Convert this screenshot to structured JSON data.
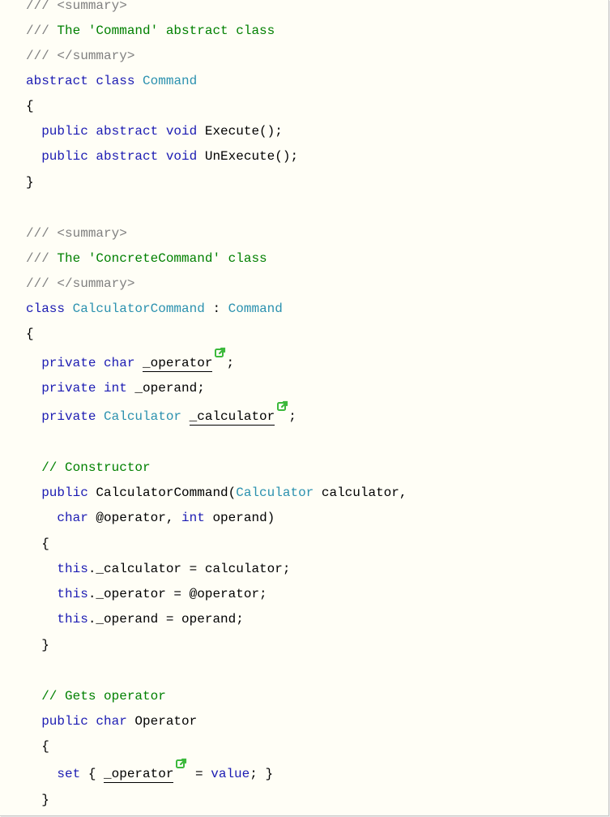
{
  "code_lines": [
    {
      "id": "l0",
      "parts": [
        {
          "t": "/// ",
          "c": "gr"
        },
        {
          "t": "<summary>",
          "c": "gr"
        }
      ]
    },
    {
      "id": "l1",
      "parts": [
        {
          "t": "/// ",
          "c": "gr"
        },
        {
          "t": "The 'Command' abstract class",
          "c": "cm"
        }
      ]
    },
    {
      "id": "l2",
      "parts": [
        {
          "t": "/// ",
          "c": "gr"
        },
        {
          "t": "</summary>",
          "c": "gr"
        }
      ]
    },
    {
      "id": "l3",
      "parts": [
        {
          "t": "abstract class ",
          "c": "kw"
        },
        {
          "t": "Command",
          "c": "ty"
        }
      ]
    },
    {
      "id": "l4",
      "parts": [
        {
          "t": "{",
          "c": ""
        }
      ]
    },
    {
      "id": "l5",
      "parts": [
        {
          "t": "  public abstract void ",
          "c": "kw"
        },
        {
          "t": "Execute();",
          "c": ""
        }
      ]
    },
    {
      "id": "l6",
      "parts": [
        {
          "t": "  public abstract void ",
          "c": "kw"
        },
        {
          "t": "UnExecute();",
          "c": ""
        }
      ]
    },
    {
      "id": "l7",
      "parts": [
        {
          "t": "}",
          "c": ""
        }
      ]
    },
    {
      "id": "l8",
      "parts": [
        {
          "t": "/// ",
          "c": "gr"
        },
        {
          "t": "<summary>",
          "c": "gr"
        }
      ]
    },
    {
      "id": "l9",
      "parts": [
        {
          "t": "/// ",
          "c": "gr"
        },
        {
          "t": "The 'ConcreteCommand' class",
          "c": "cm"
        }
      ]
    },
    {
      "id": "l10",
      "parts": [
        {
          "t": "/// ",
          "c": "gr"
        },
        {
          "t": "</summary>",
          "c": "gr"
        }
      ]
    },
    {
      "id": "l11",
      "parts": [
        {
          "t": "class ",
          "c": "kw"
        },
        {
          "t": "CalculatorCommand",
          "c": "ty"
        },
        {
          "t": " : ",
          "c": ""
        },
        {
          "t": "Command",
          "c": "ty"
        }
      ]
    },
    {
      "id": "l12",
      "parts": [
        {
          "t": "{",
          "c": ""
        }
      ]
    },
    {
      "id": "l13",
      "parts": [
        {
          "t": "  private char ",
          "c": "kw"
        },
        {
          "t": "_operator",
          "c": "",
          "link": true
        },
        {
          "t": ";",
          "c": ""
        }
      ]
    },
    {
      "id": "l14",
      "parts": [
        {
          "t": "  private int ",
          "c": "kw"
        },
        {
          "t": "_operand;",
          "c": ""
        }
      ]
    },
    {
      "id": "l15",
      "parts": [
        {
          "t": "  private ",
          "c": "kw"
        },
        {
          "t": "Calculator ",
          "c": "ty"
        },
        {
          "t": "_calculator",
          "c": "",
          "link": true
        },
        {
          "t": ";",
          "c": ""
        }
      ]
    },
    {
      "id": "l16",
      "parts": [
        {
          "t": "  // Constructor",
          "c": "cm"
        }
      ]
    },
    {
      "id": "l17",
      "parts": [
        {
          "t": "  public ",
          "c": "kw"
        },
        {
          "t": "CalculatorCommand(",
          "c": ""
        },
        {
          "t": "Calculator",
          "c": "ty"
        },
        {
          "t": " calculator,",
          "c": ""
        }
      ]
    },
    {
      "id": "l18",
      "parts": [
        {
          "t": "    char ",
          "c": "kw"
        },
        {
          "t": "@operator, ",
          "c": ""
        },
        {
          "t": "int ",
          "c": "kw"
        },
        {
          "t": "operand)",
          "c": ""
        }
      ]
    },
    {
      "id": "l19",
      "parts": [
        {
          "t": "  {",
          "c": ""
        }
      ]
    },
    {
      "id": "l20",
      "parts": [
        {
          "t": "    this",
          "c": "kw"
        },
        {
          "t": "._calculator = calculator;",
          "c": ""
        }
      ]
    },
    {
      "id": "l21",
      "parts": [
        {
          "t": "    this",
          "c": "kw"
        },
        {
          "t": "._operator = @operator;",
          "c": ""
        }
      ]
    },
    {
      "id": "l22",
      "parts": [
        {
          "t": "    this",
          "c": "kw"
        },
        {
          "t": "._operand = operand;",
          "c": ""
        }
      ]
    },
    {
      "id": "l23",
      "parts": [
        {
          "t": "  }",
          "c": ""
        }
      ]
    },
    {
      "id": "l24",
      "parts": [
        {
          "t": "  // Gets operator",
          "c": "cm"
        }
      ]
    },
    {
      "id": "l25",
      "parts": [
        {
          "t": "  public char ",
          "c": "kw"
        },
        {
          "t": "Operator",
          "c": ""
        }
      ]
    },
    {
      "id": "l26",
      "parts": [
        {
          "t": "  {",
          "c": ""
        }
      ]
    },
    {
      "id": "l27",
      "parts": [
        {
          "t": "    set ",
          "c": "kw"
        },
        {
          "t": "{ ",
          "c": ""
        },
        {
          "t": "_operator",
          "c": "",
          "link": true
        },
        {
          "t": " = ",
          "c": ""
        },
        {
          "t": "value",
          "c": "kw"
        },
        {
          "t": "; }",
          "c": ""
        }
      ]
    },
    {
      "id": "l28",
      "parts": [
        {
          "t": "  }",
          "c": ""
        }
      ]
    }
  ],
  "colors": {
    "keyword": "#1b1bb3",
    "type": "#2b91af",
    "comment": "#008000",
    "doc": "#808080",
    "link_icon": "#3cb93c"
  },
  "icons": {
    "external_link": "external-link-icon"
  }
}
